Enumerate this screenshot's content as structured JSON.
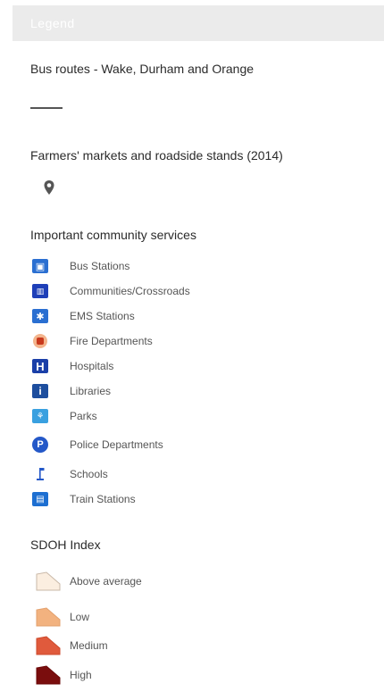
{
  "legend": {
    "header_label": "Legend"
  },
  "layers": {
    "bus_routes": {
      "title": "Bus routes - Wake, Durham and Orange",
      "symbol_color": "#555555"
    },
    "farmers_markets": {
      "title": "Farmers' markets and roadside stands (2014)",
      "symbol_icon": "map-pin-icon",
      "symbol_color": "#555555"
    },
    "community_services": {
      "title": "Important community services",
      "items": [
        {
          "label": "Bus Stations",
          "icon": "bus-icon",
          "color": "#2a6fd1"
        },
        {
          "label": "Communities/Crossroads",
          "icon": "crossroads-icon",
          "color": "#1e3fb8"
        },
        {
          "label": "EMS Stations",
          "icon": "ems-star-icon",
          "color": "#2a6fd1"
        },
        {
          "label": "Fire Departments",
          "icon": "fire-icon",
          "color": "#e46a2b"
        },
        {
          "label": "Hospitals",
          "icon": "hospital-icon",
          "color": "#1a3fa8"
        },
        {
          "label": "Libraries",
          "icon": "library-icon",
          "color": "#1d4e9e"
        },
        {
          "label": "Parks",
          "icon": "park-icon",
          "color": "#39a0e0"
        },
        {
          "label": "Police Departments",
          "icon": "police-badge-icon",
          "color": "#2458c8"
        },
        {
          "label": "Schools",
          "icon": "school-flag-icon",
          "color": "#2458c8"
        },
        {
          "label": "Train Stations",
          "icon": "train-icon",
          "color": "#1d6fd1"
        }
      ]
    },
    "sdoh_index": {
      "title": "SDOH Index",
      "items": [
        {
          "label": "Above average",
          "color": "#fbeee0"
        },
        {
          "label": "Low",
          "color": "#f2b27f"
        },
        {
          "label": "Medium",
          "color": "#e05a3c"
        },
        {
          "label": "High",
          "color": "#7a0d0d"
        }
      ]
    }
  }
}
